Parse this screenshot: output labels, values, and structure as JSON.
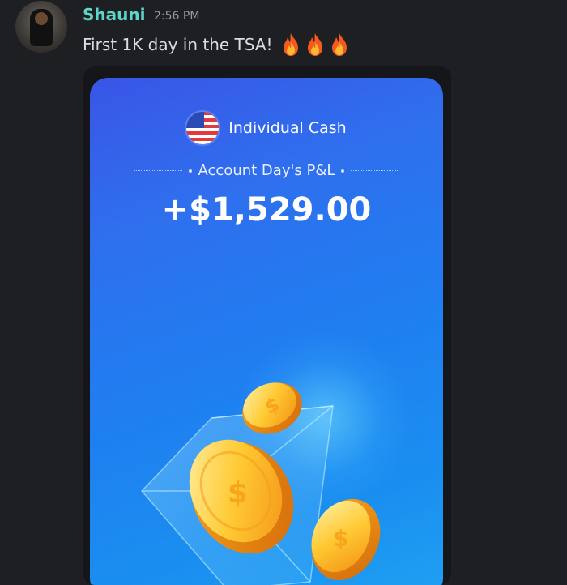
{
  "message": {
    "username": "Shauni",
    "timestamp": "2:56 PM",
    "text": "First 1K day in the TSA!",
    "emoji_icons": [
      "fire-icon",
      "fire-icon",
      "fire-icon"
    ]
  },
  "card": {
    "account_name": "Individual Cash",
    "label": "Account Day's P&L",
    "amount": "+$1,529.00",
    "flag_icon": "us-flag-icon",
    "colors": {
      "card_top": "#3a55e6",
      "card_bottom": "#1fa0f2",
      "username": "#5cd6c8",
      "background": "#1e1f22"
    }
  }
}
